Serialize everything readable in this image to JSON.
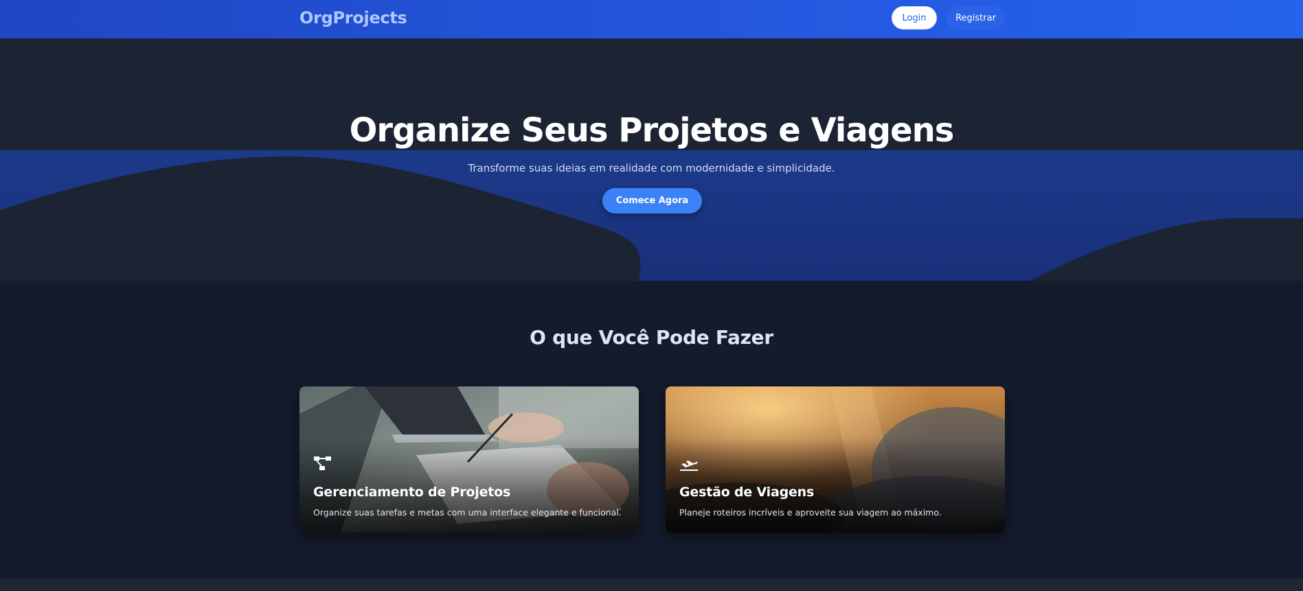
{
  "nav": {
    "brand": "OrgProjects",
    "login_label": "Login",
    "register_label": "Registrar"
  },
  "hero": {
    "title": "Organize Seus Projetos e Viagens",
    "subtitle": "Transforme suas ideias em realidade com modernidade e simplicidade.",
    "cta_label": "Comece Agora"
  },
  "features": {
    "title": "O que Você Pode Fazer",
    "cards": [
      {
        "icon": "project-diagram-icon",
        "title": "Gerenciamento de Projetos",
        "description": "Organize suas tarefas e metas com uma interface elegante e funcional."
      },
      {
        "icon": "plane-departure-icon",
        "title": "Gestão de Viagens",
        "description": "Planeje roteiros incríveis e aproveite sua viagem ao máximo."
      }
    ]
  },
  "colors": {
    "nav_start": "#1f47c4",
    "nav_end": "#2563eb",
    "accent": "#3b82f6",
    "background": "#141b2d"
  }
}
